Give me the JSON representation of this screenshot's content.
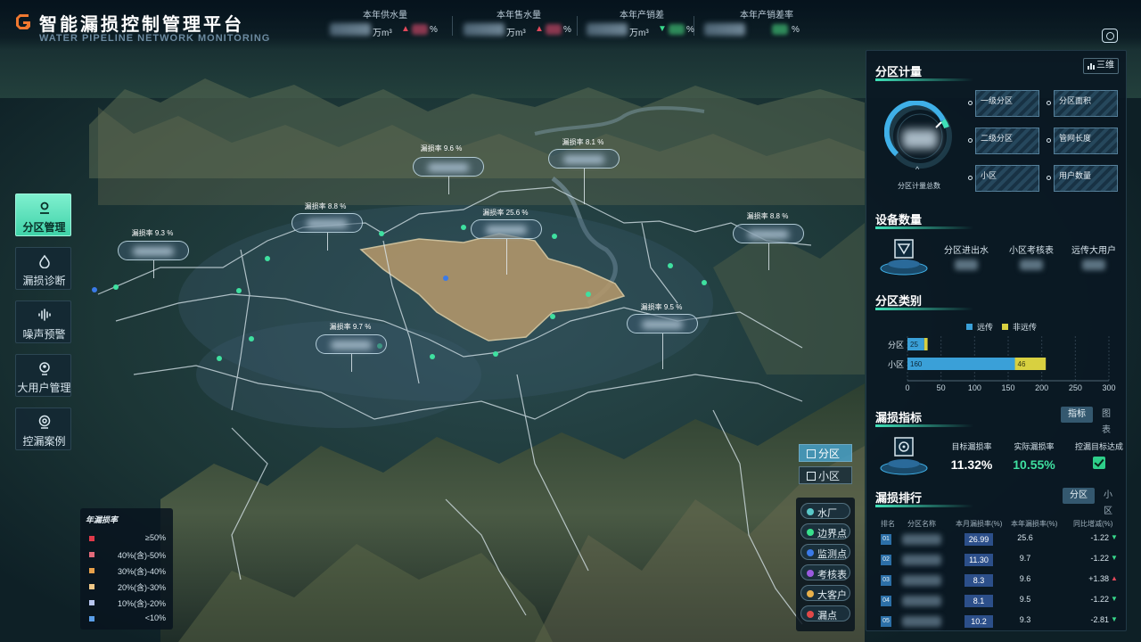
{
  "header": {
    "title": "智能漏损控制管理平台",
    "subtitle": "WATER PIPELINE NETWORK MONITORING",
    "kpis": [
      {
        "label": "本年供水量",
        "unit": "万m³",
        "arrow": "▲",
        "arrow_color": "#e0485a",
        "pct_color": "#8a3850",
        "pct_unit": "%"
      },
      {
        "label": "本年售水量",
        "unit": "万m³",
        "arrow": "▲",
        "arrow_color": "#e0485a",
        "pct_color": "#8a3850",
        "pct_unit": "%"
      },
      {
        "label": "本年产销差",
        "unit": "万m³",
        "arrow": "▼",
        "arrow_color": "#38d98c",
        "pct_color": "#2f8a5a",
        "pct_unit": "%"
      },
      {
        "label": "本年产销差率",
        "unit": "",
        "arrow": "",
        "arrow_color": "#38d98c",
        "pct_color": "#2f8a5a",
        "pct_unit": "%"
      }
    ],
    "screen_icon": "screen-record-icon"
  },
  "nav": [
    {
      "label": "分区管理",
      "icon": "location-pin-icon",
      "active": true
    },
    {
      "label": "漏损诊断",
      "icon": "water-drop-icon",
      "active": false
    },
    {
      "label": "噪声预警",
      "icon": "sound-wave-icon",
      "active": false
    },
    {
      "label": "大用户管理",
      "icon": "user-pin-icon",
      "active": false
    },
    {
      "label": "控漏案例",
      "icon": "case-icon",
      "active": false
    }
  ],
  "map_labels": [
    {
      "text": "漏损率 9.6 %"
    },
    {
      "text": "漏损率 8.1 %"
    },
    {
      "text": "漏损率 8.8 %"
    },
    {
      "text": "漏损率 25.6 %"
    },
    {
      "text": "漏损率 8.8 %"
    },
    {
      "text": "漏损率 9.3 %"
    },
    {
      "text": "漏损率 9.7 %"
    },
    {
      "text": "漏损率 9.5 %"
    }
  ],
  "legend": {
    "title": "年漏损率",
    "items": [
      {
        "label": "≥50%",
        "color": "#e03a4a"
      },
      {
        "label": "40%(含)-50%",
        "color": "#e26a7a"
      },
      {
        "label": "30%(含)-40%",
        "color": "#e8a04a"
      },
      {
        "label": "20%(含)-30%",
        "color": "#f0c888"
      },
      {
        "label": "10%(含)-20%",
        "color": "#b9c7f0"
      },
      {
        "label": "<10%",
        "color": "#5a9ee8"
      }
    ]
  },
  "zone_toggle": {
    "primary": "分区",
    "secondary": "小区"
  },
  "layers": [
    {
      "label": "水厂",
      "color": "#5ac8c8"
    },
    {
      "label": "边界点",
      "color": "#38e08c"
    },
    {
      "label": "监测点",
      "color": "#3a7ae8"
    },
    {
      "label": "考核表",
      "color": "#9a5ae0"
    },
    {
      "label": "大客户",
      "color": "#e8b04a"
    },
    {
      "label": "漏点",
      "color": "#e04848"
    }
  ],
  "panel": {
    "metering": {
      "title": "分区计量",
      "view_button": "三维",
      "gauge_caption": "分区计量总数",
      "gauge_arrow": "^",
      "counters": [
        "一级分区",
        "分区面积",
        "二级分区",
        "管网长度",
        "小区",
        "用户数量"
      ]
    },
    "devices": {
      "title": "设备数量",
      "items": [
        "分区进出水",
        "小区考核表",
        "远传大用户"
      ]
    },
    "category": {
      "title": "分区类别",
      "legend": [
        "远传",
        "非远传"
      ]
    },
    "indicators": {
      "title": "漏损指标",
      "tabs": [
        "指标",
        "图表"
      ],
      "items": [
        {
          "label": "目标漏损率",
          "value": "11.32%",
          "color": "#ffffff"
        },
        {
          "label": "实际漏损率",
          "value": "10.55%",
          "color": "#3fe0a0"
        }
      ],
      "achieved_label": "控漏目标达成"
    },
    "ranking": {
      "title": "漏损排行",
      "tabs": [
        "分区",
        "小区"
      ],
      "headers": [
        "排名",
        "分区名称",
        "本月漏损率(%)",
        "本年漏损率(%)",
        "同比增减(%)"
      ],
      "rows": [
        {
          "rank": "01",
          "month": "26.99",
          "year": "25.6",
          "change": "-1.22",
          "trend": "▼",
          "trend_color": "#38d98c"
        },
        {
          "rank": "02",
          "month": "11.30",
          "year": "9.7",
          "change": "-1.22",
          "trend": "▼",
          "trend_color": "#38d98c"
        },
        {
          "rank": "03",
          "month": "8.3",
          "year": "9.6",
          "change": "+1.38",
          "trend": "▲",
          "trend_color": "#e0485a"
        },
        {
          "rank": "04",
          "month": "8.1",
          "year": "9.5",
          "change": "-1.22",
          "trend": "▼",
          "trend_color": "#38d98c"
        },
        {
          "rank": "05",
          "month": "10.2",
          "year": "9.3",
          "change": "-2.81",
          "trend": "▼",
          "trend_color": "#38d98c"
        }
      ]
    }
  },
  "chart_data": {
    "type": "bar",
    "orientation": "horizontal",
    "stacked": true,
    "categories": [
      "分区",
      "小区"
    ],
    "series": [
      {
        "name": "远传",
        "values": [
          25,
          160
        ],
        "color": "#3aa0d8"
      },
      {
        "name": "非远传",
        "values": [
          5,
          46
        ],
        "color": "#d8d040"
      }
    ],
    "xlim": [
      0,
      300
    ],
    "xticks": [
      0,
      50,
      100,
      150,
      200,
      250,
      300
    ],
    "data_labels": [
      "25",
      "160",
      "46"
    ],
    "legend_position": "top",
    "grid": true
  }
}
